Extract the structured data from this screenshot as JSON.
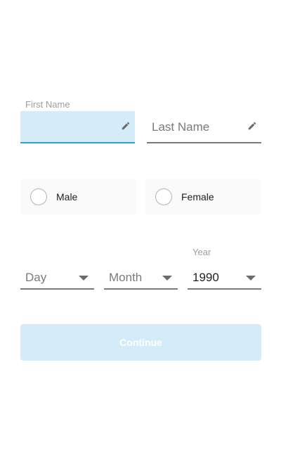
{
  "form": {
    "first_name": {
      "label": "First Name",
      "value": "",
      "icon": "pencil-icon"
    },
    "last_name": {
      "placeholder": "Last Name",
      "value": "",
      "icon": "pencil-icon"
    },
    "gender": {
      "options": [
        {
          "label": "Male",
          "selected": false
        },
        {
          "label": "Female",
          "selected": false
        }
      ]
    },
    "birthdate": {
      "day": {
        "placeholder": "Day",
        "value": ""
      },
      "month": {
        "placeholder": "Month",
        "value": ""
      },
      "year": {
        "label": "Year",
        "value": "1990"
      }
    },
    "continue_label": "Continue"
  },
  "colors": {
    "focus_fill": "#d4ebf8",
    "focus_underline": "#2aa6c9",
    "underline": "#7a7a7a",
    "button_fill": "#d4ebf8",
    "button_text": "#ffffff"
  }
}
